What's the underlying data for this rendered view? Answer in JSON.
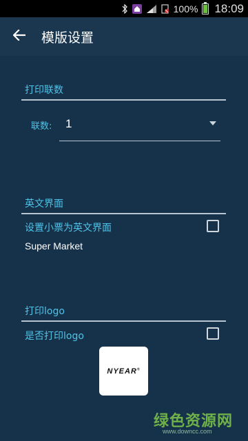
{
  "statusbar": {
    "battery_percent": "100%",
    "time": "18:09",
    "icons": [
      "bluetooth-icon",
      "home-notification-icon",
      "signal-icon",
      "sim-blocked-icon",
      "battery-icon"
    ]
  },
  "appbar": {
    "back_icon": "arrow-left-icon",
    "title": "模版设置"
  },
  "print_copies": {
    "section_title": "打印联数",
    "spinner_label": "联数:",
    "spinner_value": "1"
  },
  "english_ui": {
    "section_title": "英文界面",
    "option_label": "设置小票为英文界面",
    "option_checked": false,
    "store_name": "Super Market"
  },
  "print_logo": {
    "section_title": "打印logo",
    "option_label": "是否打印logo",
    "option_checked": false,
    "logo_text": "NYEAR",
    "logo_mark": "®"
  },
  "watermark": {
    "main": "绿色资源网",
    "sub": "www.downcc.com"
  }
}
